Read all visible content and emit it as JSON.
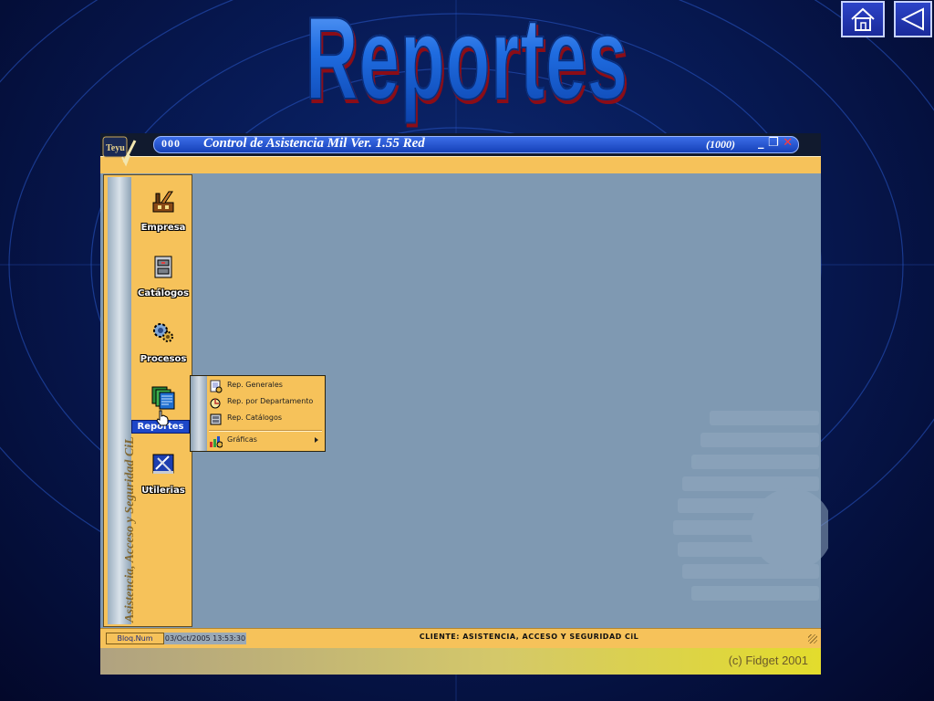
{
  "slide": {
    "title": "Reportes"
  },
  "nav": {
    "home_icon": "house-icon",
    "back_icon": "left-triangle-icon"
  },
  "window": {
    "logo_text": "Teyu",
    "title_digits": "000",
    "title": "Control de Asistencia Mil Ver. 1.55 Red",
    "count": "(1000)",
    "controls": [
      "_",
      "❐",
      "✕"
    ]
  },
  "sidebar": {
    "vertical_text": "Asistencia, Acceso y Seguridad CiL",
    "items": [
      {
        "label": "Empresa",
        "icon": "factory-icon"
      },
      {
        "label": "Catálogos",
        "icon": "file-cabinet-icon"
      },
      {
        "label": "Procesos",
        "icon": "gears-icon"
      },
      {
        "label": "Reportes",
        "icon": "reports-stack-icon",
        "active": true
      },
      {
        "label": "Utilerias",
        "icon": "tools-icon"
      }
    ]
  },
  "popup_menu": {
    "items": [
      {
        "label": "Rep. Generales",
        "icon": "report-general-icon"
      },
      {
        "label": "Rep. por Departamento",
        "icon": "report-department-icon"
      },
      {
        "label": "Rep. Catálogos",
        "icon": "report-catalog-icon"
      },
      {
        "label": "Gráficas",
        "icon": "charts-icon",
        "has_submenu": true
      }
    ]
  },
  "statusbar": {
    "bloq_num": "Bloq.Num",
    "datetime": "03/Oct/2005 13:53:30",
    "client": "CLIENTE:  ASISTENCIA, ACCESO Y SEGURIDAD CiL"
  },
  "footer": {
    "copyright": "(c) Fidget 2001"
  },
  "colors": {
    "accent_blue": "#1d47c8",
    "panel_orange": "#f6c25a",
    "client_gray": "#7f99b2"
  }
}
